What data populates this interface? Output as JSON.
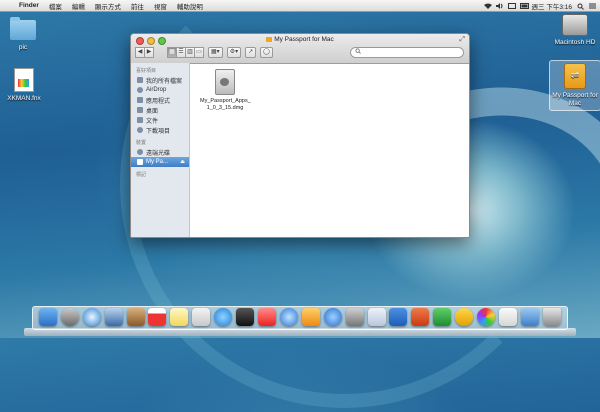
{
  "menubar": {
    "app": "Finder",
    "items": [
      "檔案",
      "編輯",
      "顯示方式",
      "前往",
      "視窗",
      "輔助說明"
    ],
    "clock": "週三 下午3:16"
  },
  "desktop": {
    "icons": [
      {
        "label": "pic"
      },
      {
        "label": "XKMAN.fnx"
      },
      {
        "label": "Macintosh HD"
      },
      {
        "label": "My Passport for Mac"
      }
    ]
  },
  "window": {
    "title": "My Passport for Mac",
    "search_placeholder": "",
    "sidebar": {
      "favorites_heading": "喜好項目",
      "favorites": [
        "我的所有檔案",
        "AirDrop",
        "應用程式",
        "桌面",
        "文件",
        "下載項目"
      ],
      "devices_heading": "裝置",
      "devices": [
        "遠端光碟",
        "My Pa..."
      ],
      "tags_heading": "標記"
    },
    "file": {
      "name_line1": "My_Passport_Apps_",
      "name_line2": "1_0_3_15.dmg"
    }
  },
  "colors": {
    "selection": "#3f7ec4",
    "usb_drive": "#f0a824"
  }
}
